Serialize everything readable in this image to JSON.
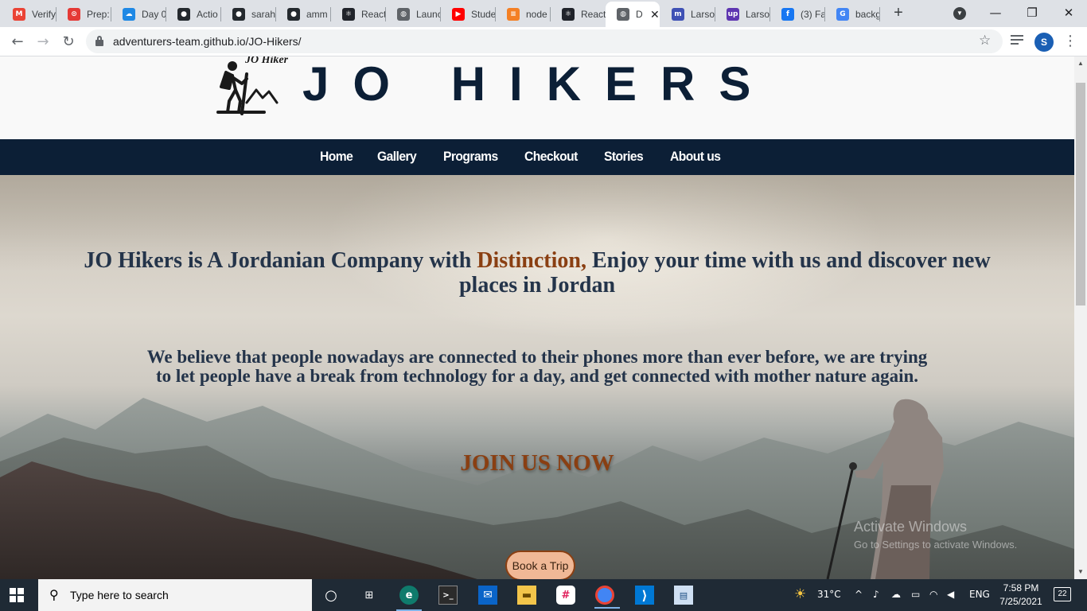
{
  "browser": {
    "tabs": [
      {
        "label": "Verify",
        "icon": "gmail-icon",
        "color": "#ea4335",
        "glyph": "M"
      },
      {
        "label": "Prep:",
        "icon": "codesignal-icon",
        "color": "#e53935",
        "glyph": "⊙"
      },
      {
        "label": "Day 0",
        "icon": "onedrive-icon",
        "color": "#1e88e5",
        "glyph": "☁"
      },
      {
        "label": "Actio",
        "icon": "github-icon",
        "color": "#24292e",
        "glyph": "●"
      },
      {
        "label": "sarah",
        "icon": "github-icon",
        "color": "#24292e",
        "glyph": "●"
      },
      {
        "label": "amm",
        "icon": "github-icon",
        "color": "#24292e",
        "glyph": "●"
      },
      {
        "label": "React",
        "icon": "react-icon",
        "color": "#20232a",
        "glyph": "⚛"
      },
      {
        "label": "Launc",
        "icon": "globe-icon",
        "color": "#5f6368",
        "glyph": "◍"
      },
      {
        "label": "Stude",
        "icon": "youtube-icon",
        "color": "#ff0000",
        "glyph": "▶"
      },
      {
        "label": "node",
        "icon": "stackoverflow-icon",
        "color": "#f48024",
        "glyph": "≡"
      },
      {
        "label": "React",
        "icon": "react-icon",
        "color": "#20232a",
        "glyph": "⚛"
      },
      {
        "label": "D",
        "icon": "globe-icon",
        "color": "#5f6368",
        "glyph": "◍",
        "active": true
      },
      {
        "label": "Larso",
        "icon": "larson-icon",
        "color": "#3f51b5",
        "glyph": "m"
      },
      {
        "label": "Larso",
        "icon": "upwork-icon",
        "color": "#5e35b1",
        "glyph": "up"
      },
      {
        "label": "(3) Fa",
        "icon": "facebook-icon",
        "color": "#1877f2",
        "glyph": "f"
      },
      {
        "label": "backg",
        "icon": "google-icon",
        "color": "#4285f4",
        "glyph": "G"
      }
    ],
    "url": "adventurers-team.github.io/JO-Hikers/",
    "profile_initial": "S"
  },
  "site": {
    "brand": "JO HIKERS",
    "logo_text": "JO Hikers",
    "nav": [
      "Home",
      "Gallery",
      "Programs",
      "Checkout",
      "Stories",
      "About us"
    ],
    "headline_pre": "JO Hikers is A Jordanian Company with ",
    "headline_accent": "Distinction,",
    "headline_post": " Enjoy your time with us and discover new places in Jordan",
    "paragraph": "We believe that people nowadays are connected to their phones more than ever before, we are trying to let people have a break from technology for a day, and get connected with mother nature again.",
    "cta": "JOIN US NOW",
    "book_button": "Book a Trip",
    "colors": {
      "navy": "#0c1f36",
      "accent": "#8a3f12",
      "button": "#f0b896"
    }
  },
  "watermark": {
    "line1": "Activate Windows",
    "line2": "Go to Settings to activate Windows."
  },
  "taskbar": {
    "search_placeholder": "Type here to search",
    "weather": "31°C",
    "language": "ENG",
    "time": "7:58 PM",
    "date": "7/25/2021",
    "notifications": "22"
  }
}
